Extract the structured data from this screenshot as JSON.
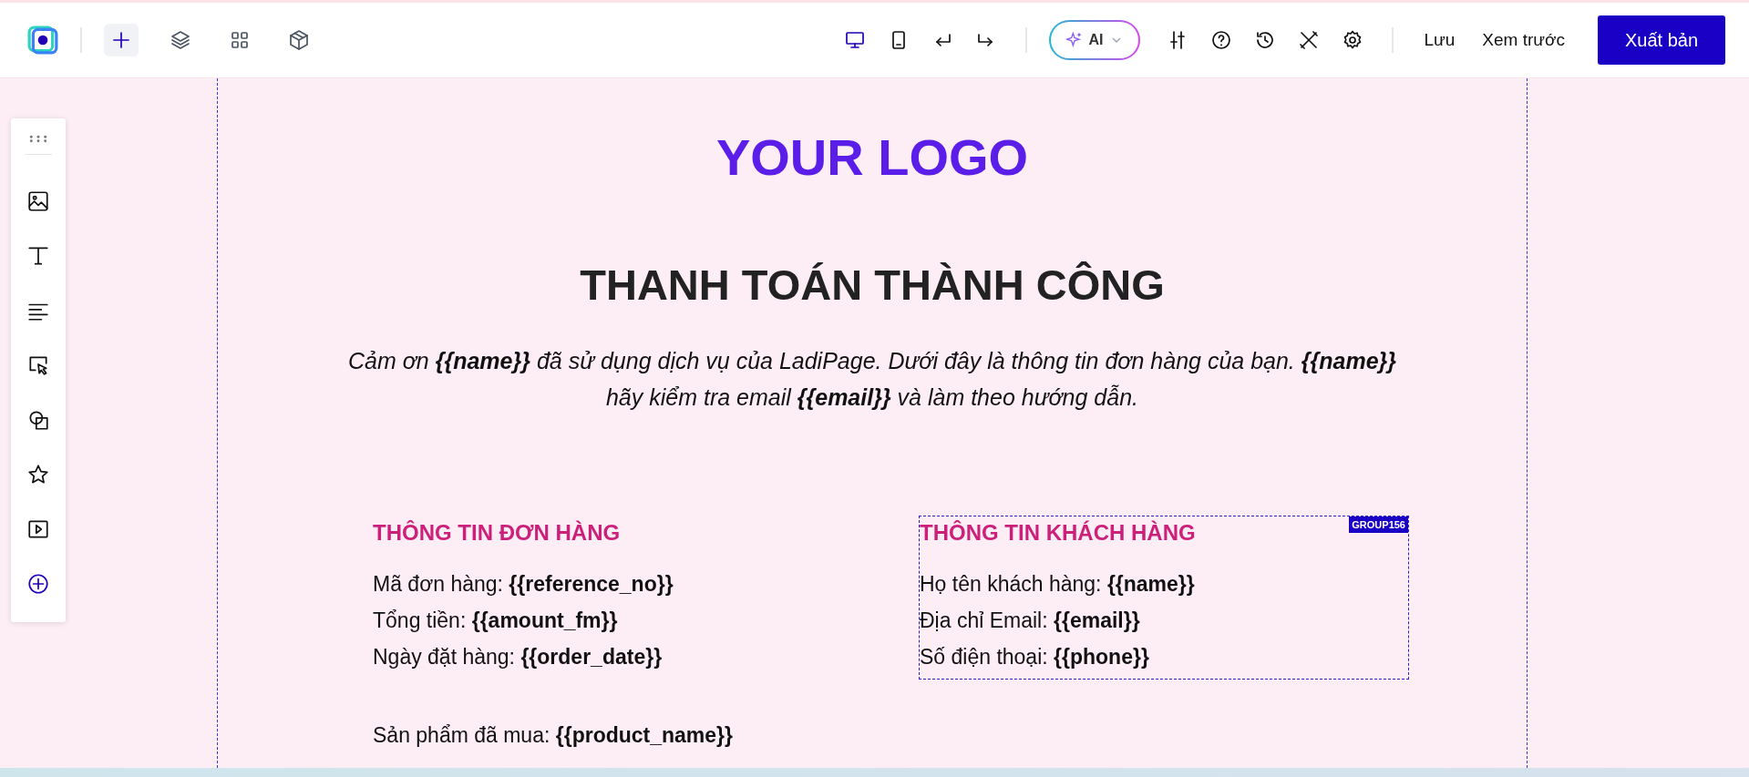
{
  "header": {
    "left_tools": [
      {
        "kind": "plus",
        "selected": true
      },
      {
        "kind": "layers",
        "selected": false
      },
      {
        "kind": "grid",
        "selected": false
      },
      {
        "kind": "box",
        "selected": false
      }
    ],
    "devices": [
      {
        "kind": "desktop",
        "selected": true
      },
      {
        "kind": "tablet",
        "selected": false
      }
    ],
    "ai_button": {
      "label": "AI"
    },
    "save": "Lưu",
    "preview": "Xem trước",
    "publish": "Xuất bản"
  },
  "canvas": {
    "logo": "YOUR LOGO",
    "heading": "THANH TOÁN THÀNH CÔNG",
    "paragraph_lines": [
      "Cảm ơn **{{name}}** đã sử dụng dịch vụ của LadiPage. Dưới đây là thông tin đơn hàng của bạn. **{{name}}**",
      "hãy kiểm tra email **{{email}}** và làm theo hướng dẫn."
    ],
    "sections": [
      {
        "title": "THÔNG TIN ĐƠN HÀNG",
        "lines": [
          "Mã đơn hàng: **{{reference_no}}**",
          "Tổng tiền: **{{amount_fm}}**",
          "Ngày đặt hàng: **{{order_date}}**"
        ]
      },
      {
        "title": "THÔNG TIN KHÁCH HÀNG",
        "group_label": "GROUP156",
        "lines": [
          "Họ tên khách hàng: **{{name}}**",
          "Địa chỉ Email: **{{email}}**",
          "Số điện thoại: **{{phone}}**"
        ]
      }
    ],
    "product_line": "Sản phẩm đã mua: **{{product_name}}**"
  }
}
